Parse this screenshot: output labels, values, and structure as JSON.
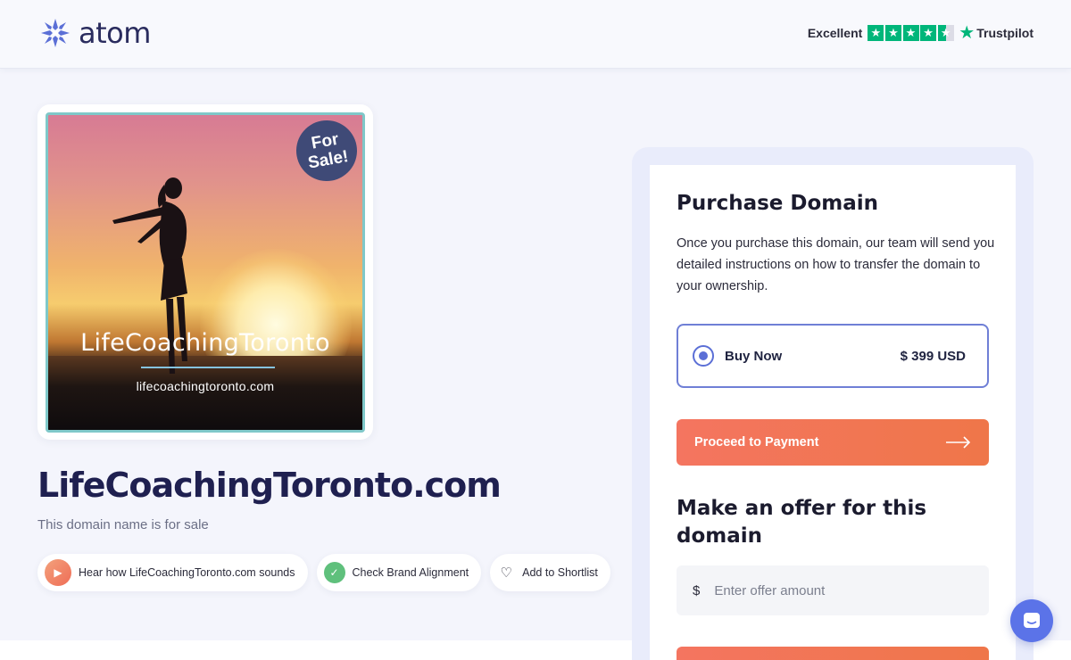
{
  "header": {
    "logo_text": "atom",
    "trust": {
      "label": "Excellent",
      "rating_stars": 4.5,
      "brand": "Trustpilot"
    }
  },
  "listing": {
    "image": {
      "badge_line1": "For",
      "badge_line2": "Sale!",
      "title": "LifeCoachingToronto",
      "url": "lifecoachingtoronto.com"
    },
    "domain": "LifeCoachingToronto.com",
    "subtitle": "This domain name is for sale",
    "actions": {
      "hear": "Hear how LifeCoachingToronto.com sounds",
      "brand": "Check Brand Alignment",
      "shortlist": "Add to Shortlist"
    }
  },
  "purchase": {
    "title": "Purchase Domain",
    "description": "Once you purchase this domain, our team will send you detailed instructions on how to transfer the domain to your ownership.",
    "buy_option": {
      "label": "Buy Now",
      "price": "$ 399 USD"
    },
    "proceed_label": "Proceed to Payment",
    "offer_title": "Make an offer for this domain",
    "offer_currency": "$",
    "offer_placeholder": "Enter offer amount"
  },
  "colors": {
    "accent": "#ef7649",
    "brand": "#2a2c5e",
    "trustpilot": "#00b67a",
    "radio": "#5b6fd6"
  }
}
